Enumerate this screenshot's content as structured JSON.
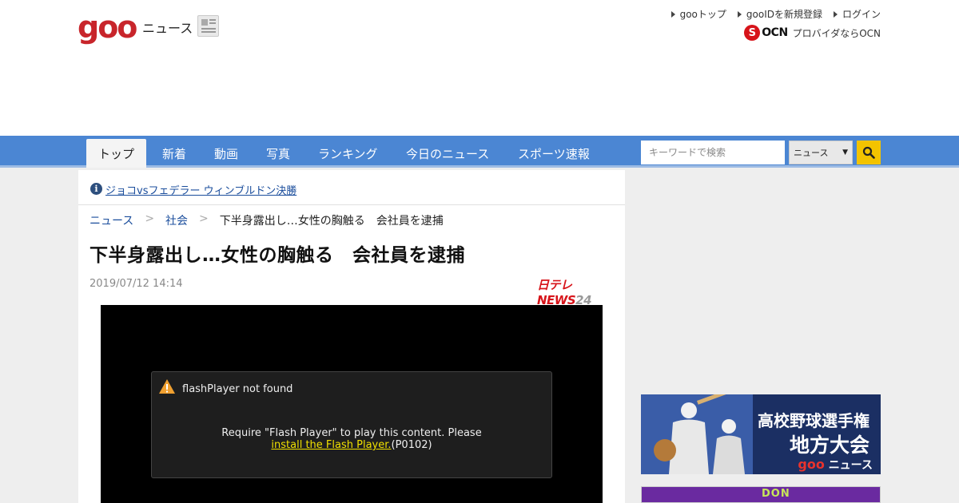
{
  "header": {
    "logo": "goo",
    "logo_sub": "ニュース",
    "links": [
      "gooトップ",
      "gooIDを新規登録",
      "ログイン"
    ],
    "ocn_badge": "OCN",
    "ocn_label": "プロバイダならOCN"
  },
  "nav": {
    "tabs": [
      "トップ",
      "新着",
      "動画",
      "写真",
      "ランキング",
      "今日のニュース",
      "スポーツ速報"
    ],
    "active_tab": "トップ",
    "search_placeholder": "キーワードで検索",
    "search_scope": "ニュース"
  },
  "topic_link": "ジョコvsフェデラー ウィンブルドン決勝",
  "breadcrumb": [
    "ニュース",
    "社会",
    "下半身露出し…女性の胸触る　会社員を逮捕"
  ],
  "breadcrumb_sep": ">",
  "article": {
    "title": "下半身露出し…女性の胸触る　会社員を逮捕",
    "date": "2019/07/12 14:14",
    "provider_main": "日テレNEWS",
    "provider_num": "24"
  },
  "player": {
    "error_title": "flashPlayer not found",
    "message_line1": "Require \"Flash Player\" to play this content. Please",
    "link_text": "install the Flash Player.",
    "code": "(P0102)"
  },
  "banner1": {
    "title": "高校野球選手権",
    "main": "地方大会",
    "footer_logo": "goo",
    "footer_text": "ニュース"
  },
  "banner2": {
    "text": "DON"
  },
  "colors": {
    "nav": "#4b86d3",
    "logo": "#c8252b",
    "search_button": "#f3c300",
    "link": "#1a4d9c"
  }
}
